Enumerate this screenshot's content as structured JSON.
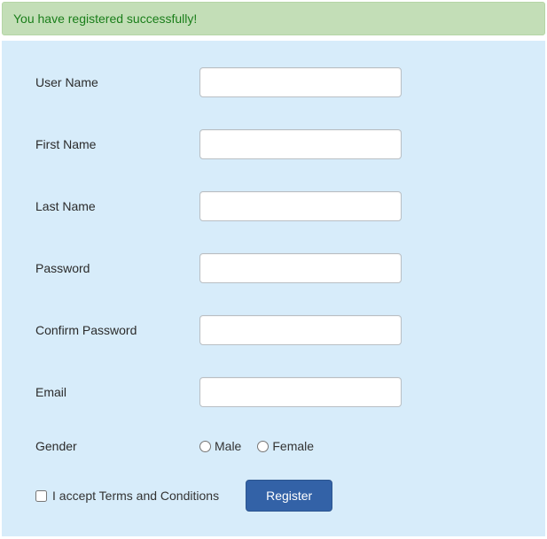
{
  "alert": {
    "message": "You have registered successfully!"
  },
  "form": {
    "username_label": "User Name",
    "firstname_label": "First Name",
    "lastname_label": "Last Name",
    "password_label": "Password",
    "confirm_password_label": "Confirm Password",
    "email_label": "Email",
    "gender_label": "Gender",
    "gender_male": "Male",
    "gender_female": "Female",
    "terms_label": "I accept Terms and Conditions",
    "register_button": "Register"
  }
}
